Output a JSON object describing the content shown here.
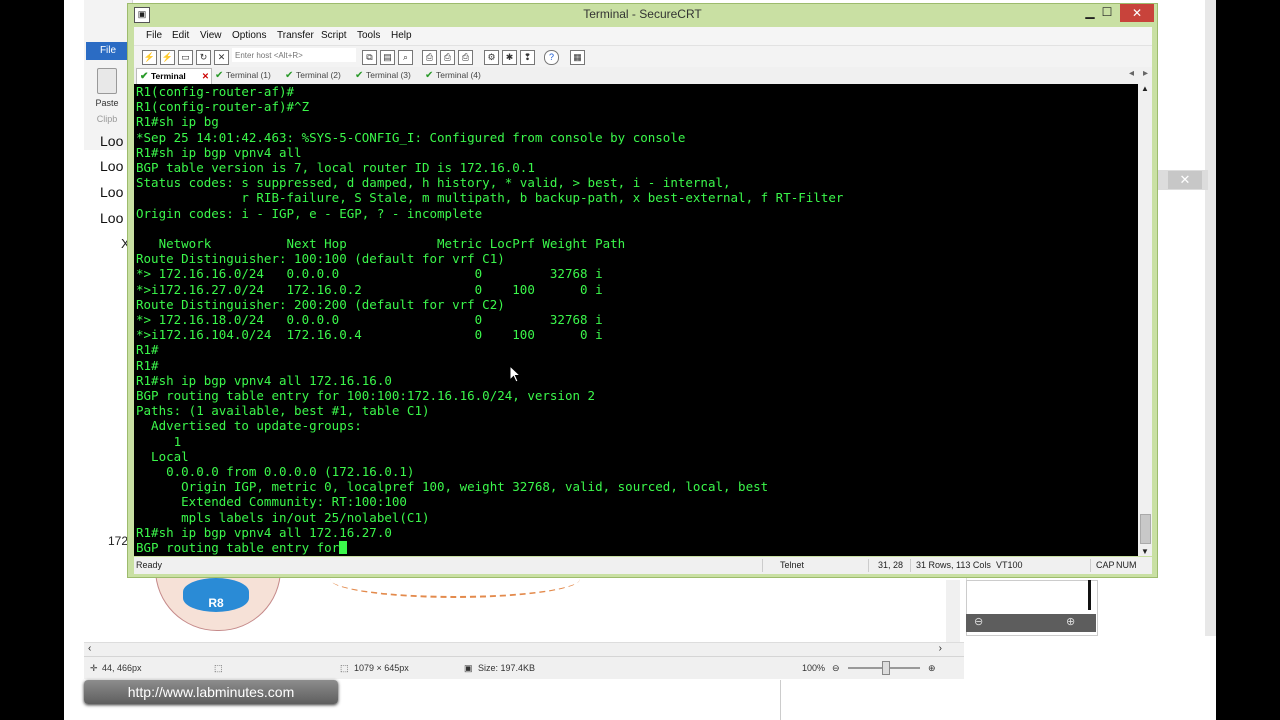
{
  "window": {
    "title": "Terminal - SecureCRT",
    "minimize_icon": "minimize-icon",
    "maximize_icon": "maximize-icon",
    "close_icon": "close-icon"
  },
  "menu": [
    "File",
    "Edit",
    "View",
    "Options",
    "Transfer",
    "Script",
    "Tools",
    "Help"
  ],
  "toolbar": {
    "host_placeholder": "Enter host <Alt+R>"
  },
  "tabs": [
    {
      "label": "Terminal",
      "active": true
    },
    {
      "label": "Terminal (1)",
      "active": false
    },
    {
      "label": "Terminal (2)",
      "active": false
    },
    {
      "label": "Terminal (3)",
      "active": false
    },
    {
      "label": "Terminal (4)",
      "active": false
    }
  ],
  "terminal": {
    "lines": [
      "R1(config-router-af)#",
      "R1(config-router-af)#^Z",
      "R1#sh ip bg",
      "*Sep 25 14:01:42.463: %SYS-5-CONFIG_I: Configured from console by console",
      "R1#sh ip bgp vpnv4 all",
      "BGP table version is 7, local router ID is 172.16.0.1",
      "Status codes: s suppressed, d damped, h history, * valid, > best, i - internal,",
      "              r RIB-failure, S Stale, m multipath, b backup-path, x best-external, f RT-Filter",
      "Origin codes: i - IGP, e - EGP, ? - incomplete",
      "",
      "   Network          Next Hop            Metric LocPrf Weight Path",
      "Route Distinguisher: 100:100 (default for vrf C1)",
      "*> 172.16.16.0/24   0.0.0.0                  0         32768 i",
      "*>i172.16.27.0/24   172.16.0.2               0    100      0 i",
      "Route Distinguisher: 200:200 (default for vrf C2)",
      "*> 172.16.18.0/24   0.0.0.0                  0         32768 i",
      "*>i172.16.104.0/24  172.16.0.4               0    100      0 i",
      "R1#",
      "R1#",
      "R1#sh ip bgp vpnv4 all 172.16.16.0",
      "BGP routing table entry for 100:100:172.16.16.0/24, version 2",
      "Paths: (1 available, best #1, table C1)",
      "  Advertised to update-groups:",
      "     1",
      "  Local",
      "    0.0.0.0 from 0.0.0.0 (172.16.0.1)",
      "      Origin IGP, metric 0, localpref 100, weight 32768, valid, sourced, local, best",
      "      Extended Community: RT:100:100",
      "      mpls labels in/out 25/nolabel(C1)",
      "R1#sh ip bgp vpnv4 all 172.16.27.0",
      "BGP routing table entry for"
    ]
  },
  "status_bar": {
    "ready": "Ready",
    "protocol": "Telnet",
    "cursor_pos": "31,  28",
    "size": "31 Rows, 113 Cols",
    "emulation": "VT100",
    "cap": "CAP",
    "num": "NUM"
  },
  "paint": {
    "file_tab": "File",
    "paste_label": "Paste",
    "clip_label": "Clipb",
    "loo_labels": [
      "Loo",
      "Loo",
      "Loo",
      "Loo"
    ],
    "x_label": "X",
    "side_number": "172",
    "router_label": "R8",
    "status": {
      "coords": "44, 466px",
      "selection": "1079 × 645px",
      "file_size": "Size: 197.4KB",
      "zoom": "100%"
    }
  },
  "watermark_url": "http://www.labminutes.com",
  "colors": {
    "terminal_fg": "#3bf74b",
    "terminal_bg": "#000000",
    "window_frame": "#c9e0a3",
    "close_button": "#c8433b"
  }
}
